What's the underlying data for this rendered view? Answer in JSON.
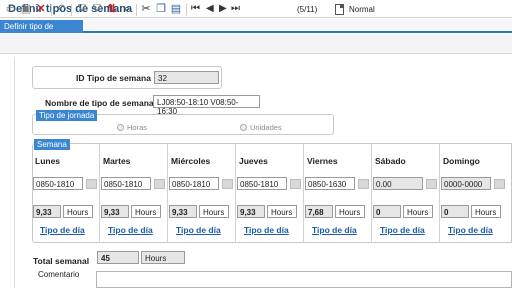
{
  "app": {
    "title": "Definir tipos de semana"
  },
  "tabs": [
    {
      "label": "Definir tipo de semana",
      "active": true
    }
  ],
  "toolbar": {
    "icons": [
      "new-icon",
      "save-icon",
      "delete-icon",
      "undo-icon",
      "filter-icon",
      "clear-filter-icon",
      "sort-icon",
      "find-icon",
      "cut-icon",
      "copy-icon",
      "paste-icon"
    ],
    "nav": {
      "first": "⏮",
      "prev": "◀",
      "next": "▶",
      "last": "⏭"
    },
    "record_count": "(5/11)",
    "view_mode": "Normal"
  },
  "form": {
    "id_label": "ID Tipo de semana",
    "id_value": "32",
    "name_label": "Nombre de tipo de semana",
    "name_value": "LJ08:50-18:10 V08:50-16:30",
    "jornada_title": "Tipo de jornada",
    "jornada_options": [
      "Horas",
      "Unidades"
    ],
    "semana_title": "Semana",
    "days": [
      {
        "name": "Lunes",
        "range": "0850-1810",
        "hours": "9,33",
        "unit": "Hours",
        "link": "Tipo de día"
      },
      {
        "name": "Martes",
        "range": "0850-1810",
        "hours": "9,33",
        "unit": "Hours",
        "link": "Tipo de día"
      },
      {
        "name": "Miércoles",
        "range": "0850-1810",
        "hours": "9,33",
        "unit": "Hours",
        "link": "Tipo de día"
      },
      {
        "name": "Jueves",
        "range": "0850-1810",
        "hours": "9,33",
        "unit": "Hours",
        "link": "Tipo de día"
      },
      {
        "name": "Viernes",
        "range": "0850-1630",
        "hours": "7,68",
        "unit": "Hours",
        "link": "Tipo de día"
      },
      {
        "name": "Sábado",
        "range": "0.00",
        "hours": "0",
        "unit": "Hours",
        "link": "Tipo de día"
      },
      {
        "name": "Domingo",
        "range": "0000-0000",
        "hours": "0",
        "unit": "Hours",
        "link": "Tipo de día"
      }
    ],
    "total_label": "Total semanal",
    "total_value": "45",
    "total_unit": "Hours",
    "comment_label": "Comentario",
    "comment_value": ""
  },
  "colors": {
    "accent": "#3a86d0",
    "title": "#1f4e79",
    "link": "#1a5da8",
    "delete": "#cc2222"
  }
}
